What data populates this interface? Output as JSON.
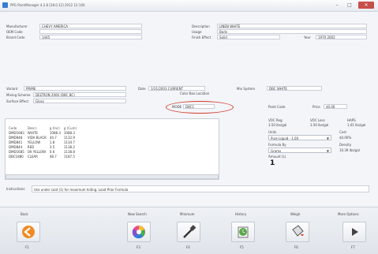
{
  "window": {
    "title": "PPG PaintManager 4.2.8 [28.0.12] 2012 12:100",
    "controls": [
      "–",
      "□",
      "✕"
    ]
  },
  "form": {
    "manufacturer": {
      "label": "Manufacturer",
      "value": "CHEVY AMERICA"
    },
    "oem_code": {
      "label": "OEM Code",
      "value": ""
    },
    "brand_code": {
      "label": "Brand Code",
      "value": "1445"
    },
    "description": {
      "label": "Description",
      "value": "LINEN WHITE"
    },
    "usage": {
      "label": "Usage",
      "value": "Body"
    },
    "finish_effect": {
      "label": "Finish Effect",
      "value": "Solid"
    },
    "year": {
      "label": "Year",
      "value": "1970 2002"
    },
    "variant": {
      "label": "Variant",
      "value": "PRIME"
    },
    "mixing_scheme": {
      "label": "Mixing Scheme",
      "value": "DELTRON 2000 (DBC BC)"
    },
    "surface_effect": {
      "label": "Surface Effect",
      "value": "Gloss"
    },
    "date": {
      "label": "Date",
      "value": "1/31/2003 CURRENT"
    },
    "color_box_location": {
      "label": "Color Box Location",
      "value": ""
    },
    "mix_system": {
      "label": "Mix System",
      "value": "DBC WHITE"
    },
    "mode": {
      "label": "MODE",
      "value": "DBC1"
    },
    "paint_code": {
      "label": "Paint Code",
      "value": ""
    },
    "price": {
      "label": "Price",
      "value": "$0.00"
    }
  },
  "table": {
    "headers": [
      "Code",
      "Descr.",
      "g (Inc)",
      "g (Cum)"
    ],
    "rows": [
      [
        "DMD1683",
        "WHITE",
        "1088.3",
        "1088.3"
      ],
      [
        "DMD848",
        "VIDA BLACK",
        "44.7",
        "1132.9"
      ],
      [
        "DMD841",
        "YELLOW",
        "1.8",
        "1134.7"
      ],
      [
        "DMD844",
        "RED",
        "3.5",
        "1138.2"
      ],
      [
        "DMD1685",
        "OX YELLOW",
        "0.6",
        "1138.8"
      ],
      [
        "DBC1880",
        "CLEAR",
        "48.7",
        "1187.5"
      ]
    ]
  },
  "right_panel": {
    "voc_reg": {
      "label": "VOC Reg.",
      "value": "3.50 lbs/gal"
    },
    "voc_less": {
      "label": "VOC Less",
      "value": "3.50 lbs/gal"
    },
    "haps": {
      "label": "HAPS",
      "value": "1.61 lbs/gal"
    },
    "units": {
      "label": "Units",
      "value": "Pure Liquid - 1.00"
    },
    "cost": {
      "label": "Cost",
      "value": "$0.00%"
    },
    "formula_by": {
      "label": "Formula By",
      "value": "Grams"
    },
    "density": {
      "label": "Density",
      "value": "10.39 lbs/gal"
    },
    "amount": {
      "label": "Amount (L)",
      "value": "1"
    }
  },
  "instructions": {
    "label": "Instructions",
    "value": "Use under coat (1) for maximum hiding. Load Prior Formula"
  },
  "toolbar": [
    {
      "label": "Back",
      "key": "F1",
      "icon": "back-arrow-icon"
    },
    {
      "label": "New Search",
      "key": "F3",
      "icon": "color-wheel-icon"
    },
    {
      "label": "Minimum",
      "key": "F4",
      "icon": "eyedropper-icon"
    },
    {
      "label": "History",
      "key": "F5",
      "icon": "history-icon"
    },
    {
      "label": "Weigh",
      "key": "F6",
      "icon": "paint-bucket-icon"
    },
    {
      "label": "More Options",
      "key": "F7",
      "icon": "play-arrow-icon"
    }
  ],
  "colors": {
    "accent": "#f08a24",
    "highlight": "#d23a2a"
  }
}
